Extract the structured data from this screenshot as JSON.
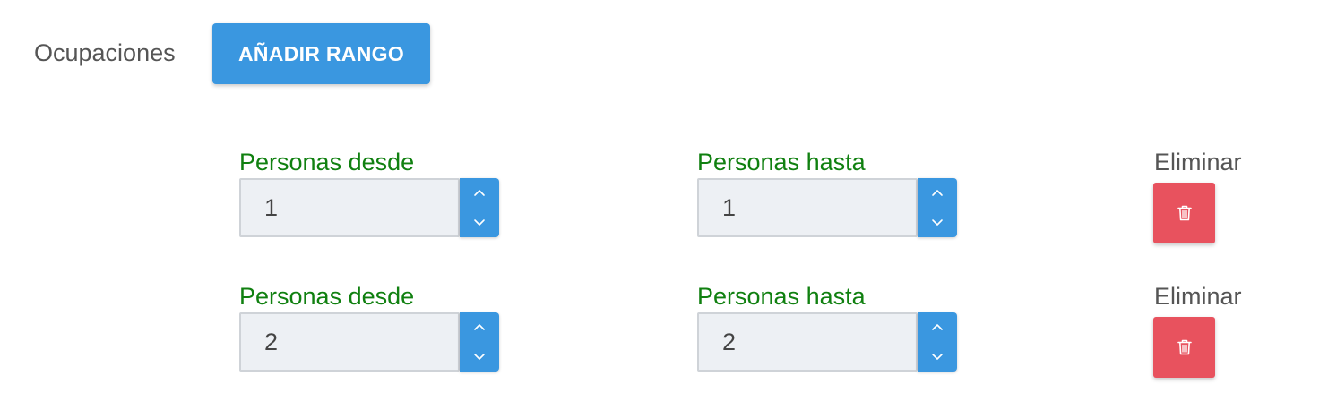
{
  "section": {
    "label": "Ocupaciones",
    "add_button_label": "AÑADIR RANGO"
  },
  "colors": {
    "primary": "#3a97e0",
    "danger": "#e8525e",
    "field_label": "#108010",
    "input_background": "#edf0f4"
  },
  "icons": {
    "stepper_up": "chevron-up-icon",
    "stepper_down": "chevron-down-icon",
    "delete": "trash-icon"
  },
  "ranges": [
    {
      "from_label": "Personas desde",
      "from_value": "1",
      "to_label": "Personas hasta",
      "to_value": "1",
      "delete_label": "Eliminar"
    },
    {
      "from_label": "Personas desde",
      "from_value": "2",
      "to_label": "Personas hasta",
      "to_value": "2",
      "delete_label": "Eliminar"
    }
  ]
}
